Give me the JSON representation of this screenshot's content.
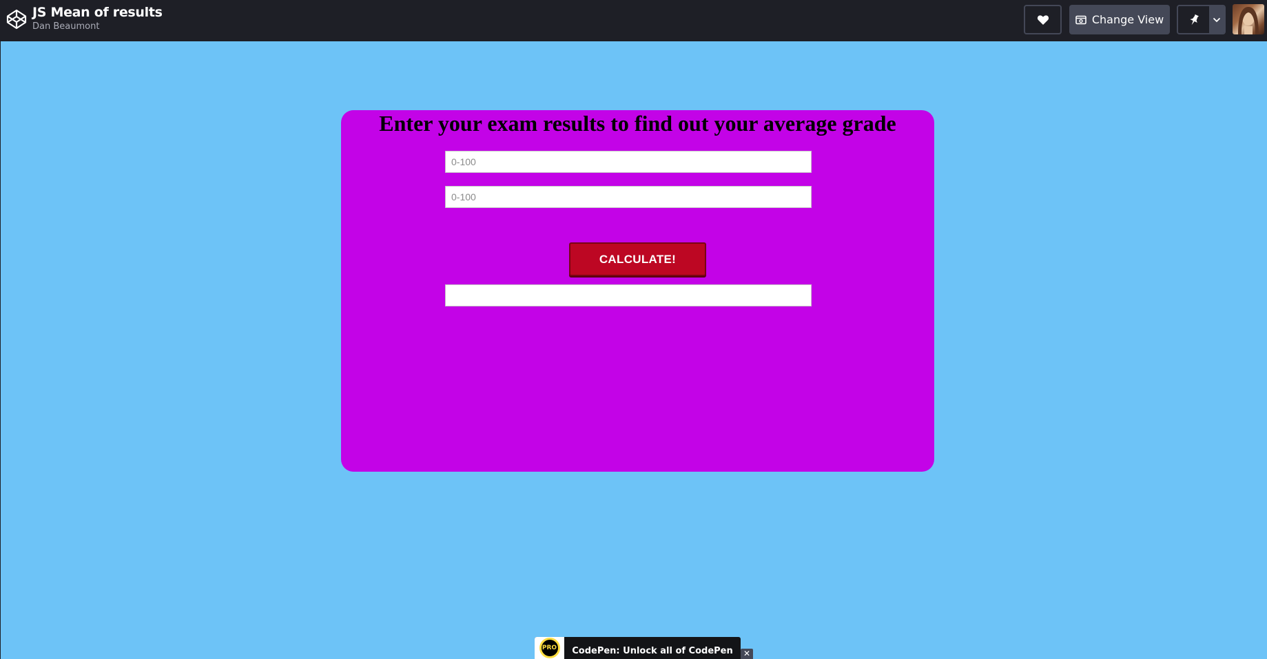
{
  "header": {
    "pen_title": "JS Mean of results",
    "author": "Dan Beaumont",
    "change_view_label": "Change View",
    "icons": [
      "codepen-logo-icon",
      "heart-icon",
      "change-view-icon",
      "pin-icon",
      "chevron-down-icon"
    ]
  },
  "form": {
    "heading": "Enter your exam results to find out your average grade",
    "input1_placeholder": "0-100",
    "input2_placeholder": "0-100",
    "input1_value": "",
    "input2_value": "",
    "result_value": "",
    "calculate_label": "CALCULATE!"
  },
  "promo": {
    "badge": "PRO",
    "text": "CodePen: Unlock all of CodePen",
    "close": "✕"
  },
  "colors": {
    "topbar_bg": "#1e1f26",
    "preview_bg": "#6dc3f7",
    "card_bg": "#c303e7",
    "button_bg": "#bd0723"
  }
}
